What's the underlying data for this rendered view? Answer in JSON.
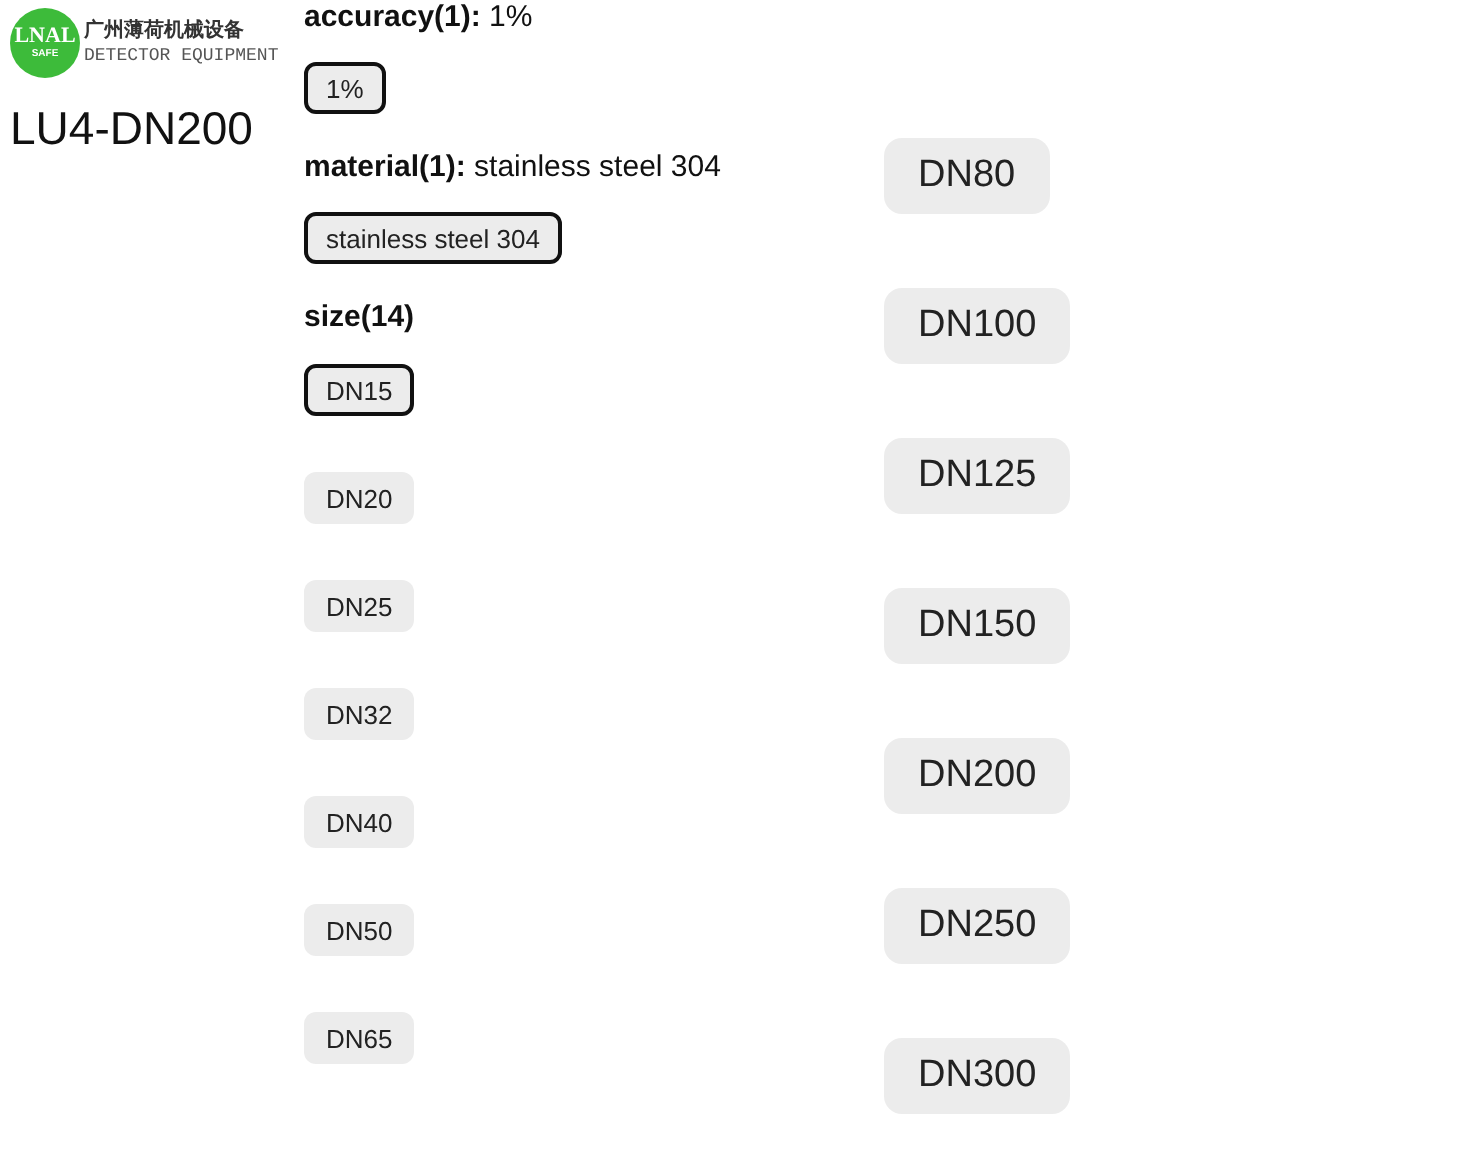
{
  "logo": {
    "badge": "LNAL",
    "badge_sub": "SAFE",
    "company": "广州薄荷机械设备",
    "tagline": "DETECTOR EQUIPMENT"
  },
  "product": {
    "title": "LU4-DN200"
  },
  "attributes": [
    {
      "name": "accuracy(1):",
      "value": "1%",
      "options": [
        {
          "label": "1%",
          "selected": true
        }
      ]
    },
    {
      "name": "material(1):",
      "value": "stainless steel 304",
      "options": [
        {
          "label": "stainless steel 304",
          "selected": true
        }
      ]
    },
    {
      "name": "size(14)",
      "options": [
        {
          "label": "DN15",
          "selected": true
        },
        {
          "label": "DN20",
          "selected": false
        },
        {
          "label": "DN25",
          "selected": false
        },
        {
          "label": "DN32",
          "selected": false
        },
        {
          "label": "DN40",
          "selected": false
        },
        {
          "label": "DN50",
          "selected": false
        },
        {
          "label": "DN65",
          "selected": false
        },
        {
          "label": "DN80",
          "selected": false
        },
        {
          "label": "DN100",
          "selected": false
        },
        {
          "label": "DN125",
          "selected": false
        },
        {
          "label": "DN150",
          "selected": false
        },
        {
          "label": "DN200",
          "selected": false
        },
        {
          "label": "DN250",
          "selected": false
        },
        {
          "label": "DN300",
          "selected": false
        }
      ]
    }
  ]
}
